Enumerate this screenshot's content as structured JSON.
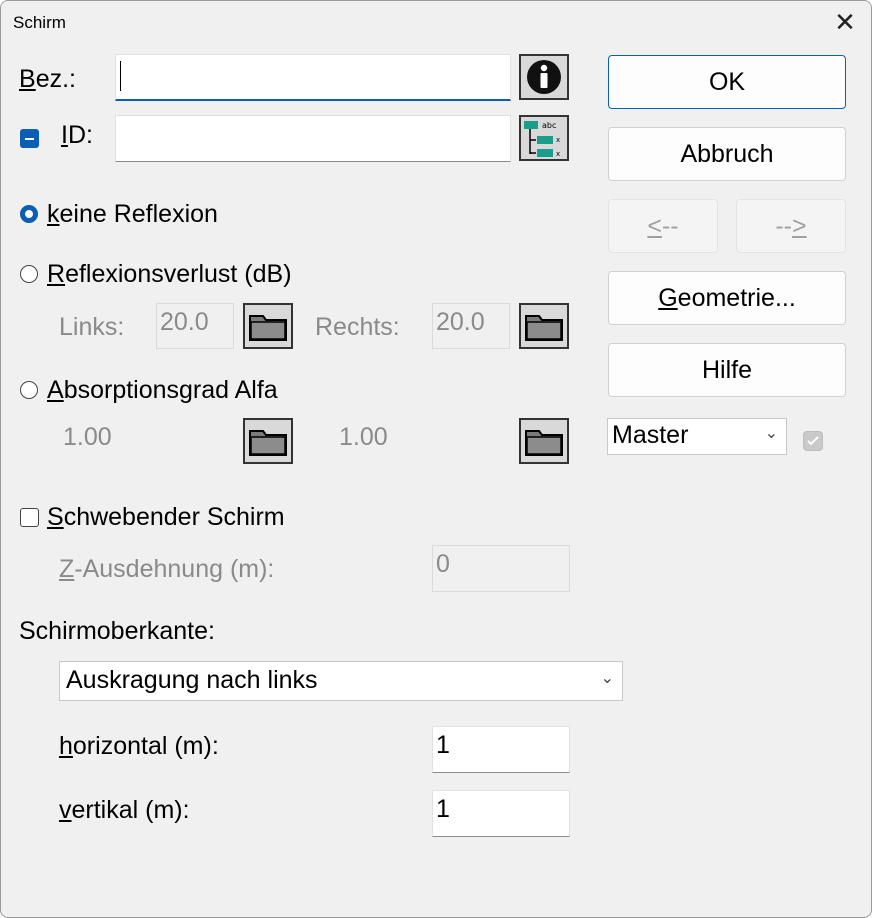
{
  "window": {
    "title": "Schirm",
    "close_glyph": "✕"
  },
  "bez": {
    "label": "Bez.:",
    "accel": "B",
    "rest": "ez.:",
    "value": ""
  },
  "id": {
    "label": "ID:",
    "accel": "I",
    "rest": "D:",
    "value": ""
  },
  "reflection": {
    "none": {
      "label": "keine Reflexion",
      "accel": "k",
      "rest": "eine Reflexion",
      "selected": true
    },
    "loss": {
      "label": "Reflexionsverlust (dB)",
      "accel": "R",
      "rest": "eflexionsverlust (dB)",
      "selected": false,
      "left_label": "Links:",
      "left_value": "20.0",
      "right_label": "Rechts:",
      "right_value": "20.0"
    },
    "absorption": {
      "label": "Absorptionsgrad Alfa",
      "accel": "A",
      "rest": "bsorptionsgrad Alfa",
      "selected": false,
      "left_value": "1.00",
      "right_value": "1.00"
    }
  },
  "floating": {
    "label": "Schwebender Schirm",
    "accel": "S",
    "rest": "chwebender Schirm",
    "checked": false,
    "z_label": "Z-Ausdehnung (m):",
    "z_accel": "Z",
    "z_rest": "-Ausdehnung (m):",
    "z_value": "0"
  },
  "top_edge": {
    "label": "Schirmoberkante:",
    "selected": "Auskragung nach links",
    "horizontal_label": "horizontal (m):",
    "horizontal_accel": "h",
    "horizontal_rest": "orizontal (m):",
    "horizontal_value": "1",
    "vertical_label": "vertikal (m):",
    "vertical_accel": "v",
    "vertical_rest": "ertikal (m):",
    "vertical_value": "1"
  },
  "buttons": {
    "ok": "OK",
    "cancel": "Abbruch",
    "prev": "<--",
    "prev_accel": "<",
    "prev_rest": "--",
    "next": "-->",
    "next_pre": "--",
    "next_accel": ">",
    "geometry": "Geometrie...",
    "geometry_accel": "G",
    "geometry_rest": "eometrie...",
    "help": "Hilfe"
  },
  "variant": {
    "selected": "Master",
    "checked": true
  },
  "icons": {
    "info": "info-icon",
    "id_tree": "id-tree-icon",
    "folder": "folder-icon"
  },
  "colors": {
    "accent": "#0a5fb4",
    "teal": "#1a9e8a",
    "background": "#f0f0f0"
  }
}
